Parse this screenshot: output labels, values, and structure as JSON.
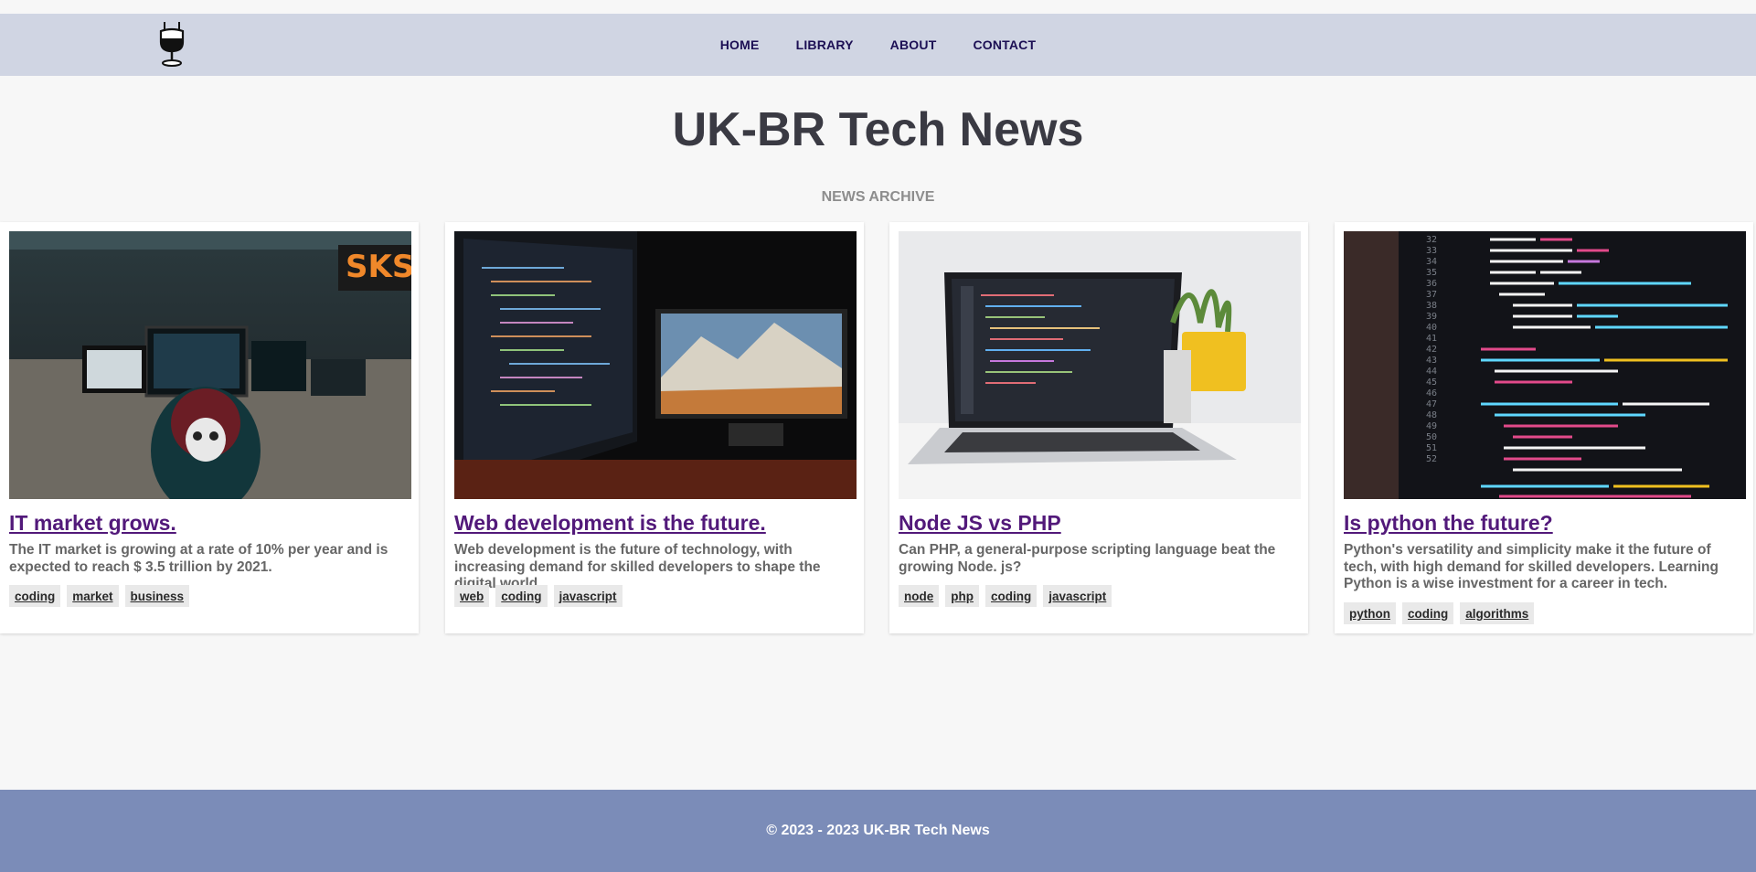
{
  "nav": {
    "logo_icon": "microphone-logo-icon",
    "links": [
      "HOME",
      "LIBRARY",
      "ABOUT",
      "CONTACT"
    ]
  },
  "header": {
    "title": "UK-BR Tech News",
    "section_label": "NEWS ARCHIVE"
  },
  "articles": [
    {
      "image": "office-hacker-photo",
      "title": "IT market grows.",
      "description": "The IT market is growing at a rate of 10% per year and is expected to reach $ 3.5 trillion by 2021.",
      "tags": [
        "coding",
        "market",
        "business"
      ]
    },
    {
      "image": "dual-monitor-code-photo",
      "title": "Web development is the future.",
      "description": "Web development is the future of technology, with increasing demand for skilled developers to shape the digital world.",
      "tags": [
        "web",
        "coding",
        "javascript"
      ]
    },
    {
      "image": "laptop-plant-photo",
      "title": "Node JS vs PHP",
      "description": "Can PHP, a general-purpose scripting language beat the growing Node. js?",
      "tags": [
        "node",
        "php",
        "coding",
        "javascript"
      ]
    },
    {
      "image": "python-code-screen-photo",
      "title": "Is python the future?",
      "description": "Python's versatility and simplicity make it the future of tech, with high demand for skilled developers. Learning Python is a wise investment for a career in tech.",
      "tags": [
        "python",
        "coding",
        "algorithms"
      ]
    }
  ],
  "footer": {
    "text": "© 2023 - 2023 UK-BR Tech News"
  },
  "colors": {
    "navbar_bg": "#d0d5e3",
    "footer_bg": "#7b8cb8",
    "link_purple": "#52197a",
    "nav_text": "#1c0f54"
  }
}
